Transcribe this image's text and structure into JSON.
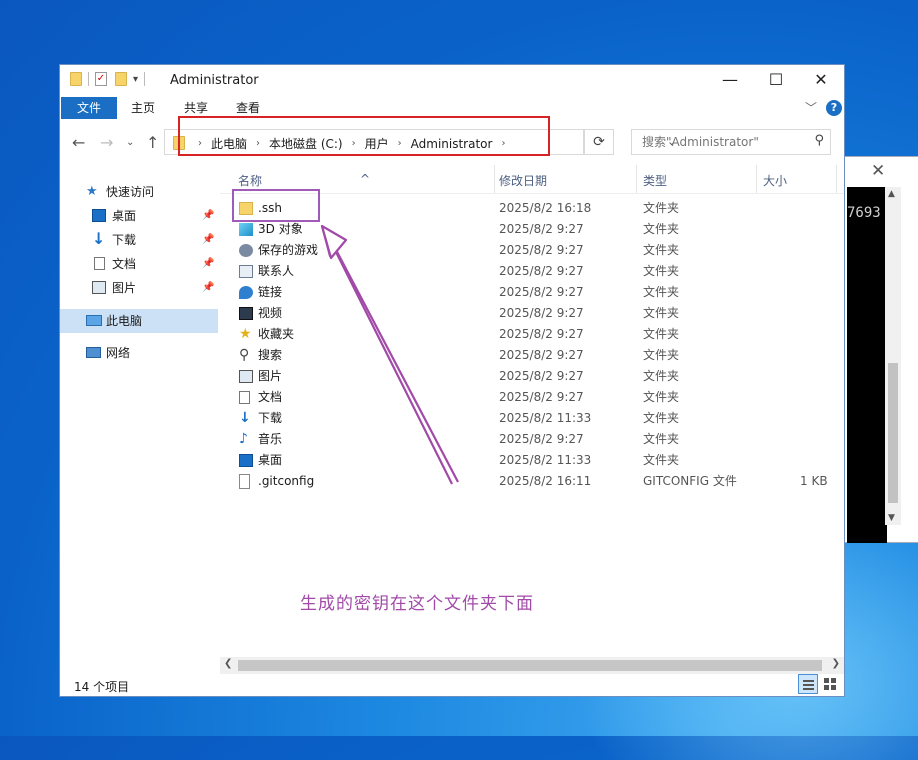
{
  "window": {
    "title": "Administrator"
  },
  "ribbon": {
    "tabs": [
      "文件",
      "主页",
      "共享",
      "查看"
    ]
  },
  "address": {
    "crumbs": [
      "此电脑",
      "本地磁盘 (C:)",
      "用户",
      "Administrator"
    ],
    "search_placeholder": "搜索\"Administrator\""
  },
  "nav": {
    "items": [
      {
        "label": "快速访问",
        "icon": "star-icon"
      },
      {
        "label": "桌面",
        "icon": "desktop-icon",
        "pinned": true
      },
      {
        "label": "下载",
        "icon": "download-icon",
        "pinned": true
      },
      {
        "label": "文档",
        "icon": "document-icon",
        "pinned": true
      },
      {
        "label": "图片",
        "icon": "picture-icon",
        "pinned": true
      },
      {
        "label": "此电脑",
        "icon": "computer-icon",
        "selected": true
      },
      {
        "label": "网络",
        "icon": "network-icon"
      }
    ]
  },
  "columns": {
    "name": "名称",
    "date": "修改日期",
    "type": "类型",
    "size": "大小"
  },
  "files": [
    {
      "name": ".ssh",
      "date": "2025/8/2 16:18",
      "type": "文件夹",
      "size": "",
      "icon": "folder-icon"
    },
    {
      "name": "3D 对象",
      "date": "2025/8/2 9:27",
      "type": "文件夹",
      "size": "",
      "icon": "3d-objects-icon"
    },
    {
      "name": "保存的游戏",
      "date": "2025/8/2 9:27",
      "type": "文件夹",
      "size": "",
      "icon": "saved-games-icon"
    },
    {
      "name": "联系人",
      "date": "2025/8/2 9:27",
      "type": "文件夹",
      "size": "",
      "icon": "contacts-icon"
    },
    {
      "name": "链接",
      "date": "2025/8/2 9:27",
      "type": "文件夹",
      "size": "",
      "icon": "links-icon"
    },
    {
      "name": "视频",
      "date": "2025/8/2 9:27",
      "type": "文件夹",
      "size": "",
      "icon": "video-icon"
    },
    {
      "name": "收藏夹",
      "date": "2025/8/2 9:27",
      "type": "文件夹",
      "size": "",
      "icon": "favorites-icon"
    },
    {
      "name": "搜索",
      "date": "2025/8/2 9:27",
      "type": "文件夹",
      "size": "",
      "icon": "search-icon"
    },
    {
      "name": "图片",
      "date": "2025/8/2 9:27",
      "type": "文件夹",
      "size": "",
      "icon": "picture-icon"
    },
    {
      "name": "文档",
      "date": "2025/8/2 9:27",
      "type": "文件夹",
      "size": "",
      "icon": "document-icon"
    },
    {
      "name": "下载",
      "date": "2025/8/2 11:33",
      "type": "文件夹",
      "size": "",
      "icon": "download-icon"
    },
    {
      "name": "音乐",
      "date": "2025/8/2 9:27",
      "type": "文件夹",
      "size": "",
      "icon": "music-icon"
    },
    {
      "name": "桌面",
      "date": "2025/8/2 11:33",
      "type": "文件夹",
      "size": "",
      "icon": "desktop-icon"
    },
    {
      "name": ".gitconfig",
      "date": "2025/8/2 16:11",
      "type": "GITCONFIG 文件",
      "size": "1 KB",
      "icon": "file-icon"
    }
  ],
  "status": {
    "count": "14 个项目"
  },
  "annotation": {
    "text": "生成的密钥在这个文件夹下面"
  },
  "background_terminal": {
    "text": "7693"
  },
  "colors": {
    "accent": "#1a6fc4",
    "annotation": "#a14aa8",
    "highlight_red": "#d62424"
  }
}
